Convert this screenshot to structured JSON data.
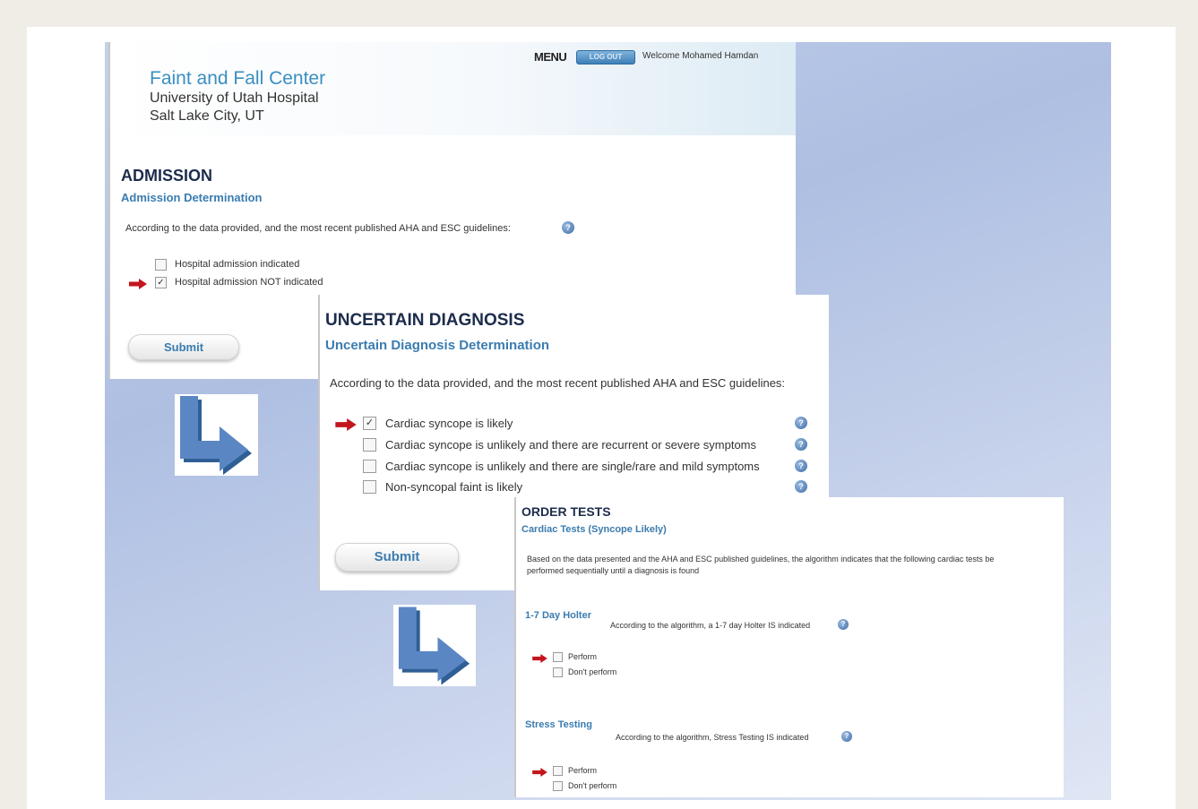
{
  "header": {
    "center_name": "Faint and Fall Center",
    "hospital": "University of Utah Hospital",
    "city": "Salt Lake City, UT",
    "menu_label": "MENU",
    "logout_label": "LOG OUT",
    "welcome": "Welcome Mohamed Hamdan"
  },
  "admission": {
    "title": "ADMISSION",
    "subtitle": "Admission Determination",
    "intro": "According to the data provided, and the most recent published AHA and ESC guidelines:",
    "options": [
      {
        "label": "Hospital admission indicated",
        "checked": false,
        "highlighted": false
      },
      {
        "label": "Hospital admission NOT indicated",
        "checked": true,
        "highlighted": true
      }
    ],
    "submit_label": "Submit"
  },
  "uncertain": {
    "title": "UNCERTAIN DIAGNOSIS",
    "subtitle": "Uncertain Diagnosis Determination",
    "intro": "According to the data provided, and the most recent published AHA and ESC guidelines:",
    "options": [
      {
        "label": "Cardiac syncope is likely",
        "checked": true,
        "highlighted": true
      },
      {
        "label": "Cardiac syncope is unlikely and there are recurrent or severe symptoms",
        "checked": false,
        "highlighted": false
      },
      {
        "label": "Cardiac syncope is unlikely and there are single/rare and mild symptoms",
        "checked": false,
        "highlighted": false
      },
      {
        "label": "Non-syncopal faint is likely",
        "checked": false,
        "highlighted": false
      }
    ],
    "submit_label": "Submit"
  },
  "order_tests": {
    "title": "ORDER TESTS",
    "subtitle": "Cardiac Tests (Syncope Likely)",
    "intro_line1": "Based on the data presented and the AHA and ESC published guidelines, the algorithm indicates that the following cardiac tests be",
    "intro_line2": "performed sequentially until a diagnosis is found",
    "tests": [
      {
        "name": "1-7 Day Holter",
        "note": "According to the algorithm, a 1-7 day Holter IS indicated",
        "perform_label": "Perform",
        "dont_perform_label": "Don't perform"
      },
      {
        "name": "Stress Testing",
        "note": "According to the algorithm, Stress Testing IS indicated",
        "perform_label": "Perform",
        "dont_perform_label": "Don't perform"
      }
    ]
  },
  "icons": {
    "help": "question-mark-circle-icon",
    "pointer": "red-arrow-icon",
    "flow": "curved-down-right-arrow-icon"
  },
  "colors": {
    "accent_blue": "#3a7cb0",
    "title_dark": "#1c2c4c",
    "pointer_red": "#c3161c"
  }
}
